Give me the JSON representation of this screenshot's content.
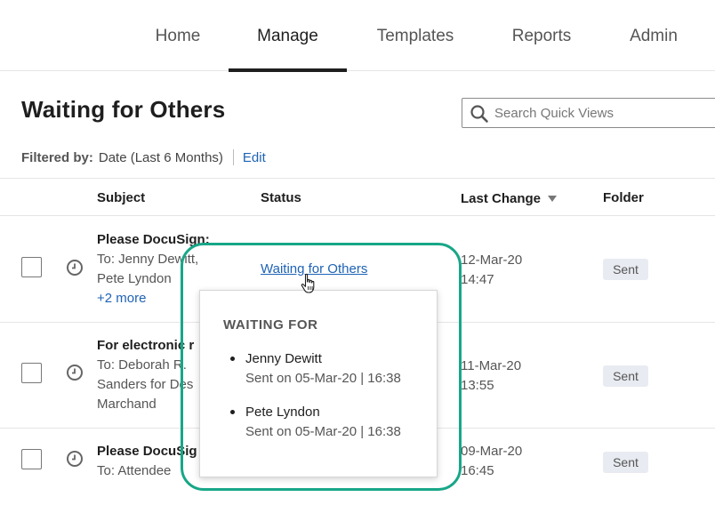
{
  "nav": {
    "items": [
      {
        "label": "Home"
      },
      {
        "label": "Manage",
        "active": true
      },
      {
        "label": "Templates"
      },
      {
        "label": "Reports"
      },
      {
        "label": "Admin"
      }
    ]
  },
  "page": {
    "title": "Waiting for Others"
  },
  "search": {
    "placeholder": "Search Quick Views",
    "icon": "search-icon"
  },
  "filter": {
    "label": "Filtered by:",
    "value": "Date (Last 6 Months)",
    "edit_label": "Edit"
  },
  "table": {
    "headers": {
      "subject": "Subject",
      "status": "Status",
      "last_change": "Last Change",
      "folder": "Folder"
    },
    "rows": [
      {
        "subject": "Please DocuSign:",
        "recipient_lines": [
          "To: Jenny Dewitt,",
          "Pete Lyndon"
        ],
        "more": "+2 more",
        "status": "Waiting for Others",
        "date": "12-Mar-20",
        "time": "14:47",
        "folder": "Sent"
      },
      {
        "subject": "For electronic r",
        "recipient_lines": [
          "To: Deborah R.",
          "Sanders for Des",
          "Marchand"
        ],
        "date": "11-Mar-20",
        "time": "13:55",
        "folder": "Sent"
      },
      {
        "subject": "Please DocuSig",
        "recipient_lines": [
          "To: Attendee"
        ],
        "date": "09-Mar-20",
        "time": "16:45",
        "folder": "Sent"
      }
    ]
  },
  "popover": {
    "title": "WAITING FOR",
    "items": [
      {
        "name": "Jenny Dewitt",
        "sent": "Sent on 05-Mar-20 | 16:38"
      },
      {
        "name": "Pete Lyndon",
        "sent": "Sent on 05-Mar-20 | 16:38"
      }
    ]
  },
  "colors": {
    "accent_link": "#1e63b5",
    "highlight": "#17a787",
    "badge_bg": "#e8ebf1"
  }
}
